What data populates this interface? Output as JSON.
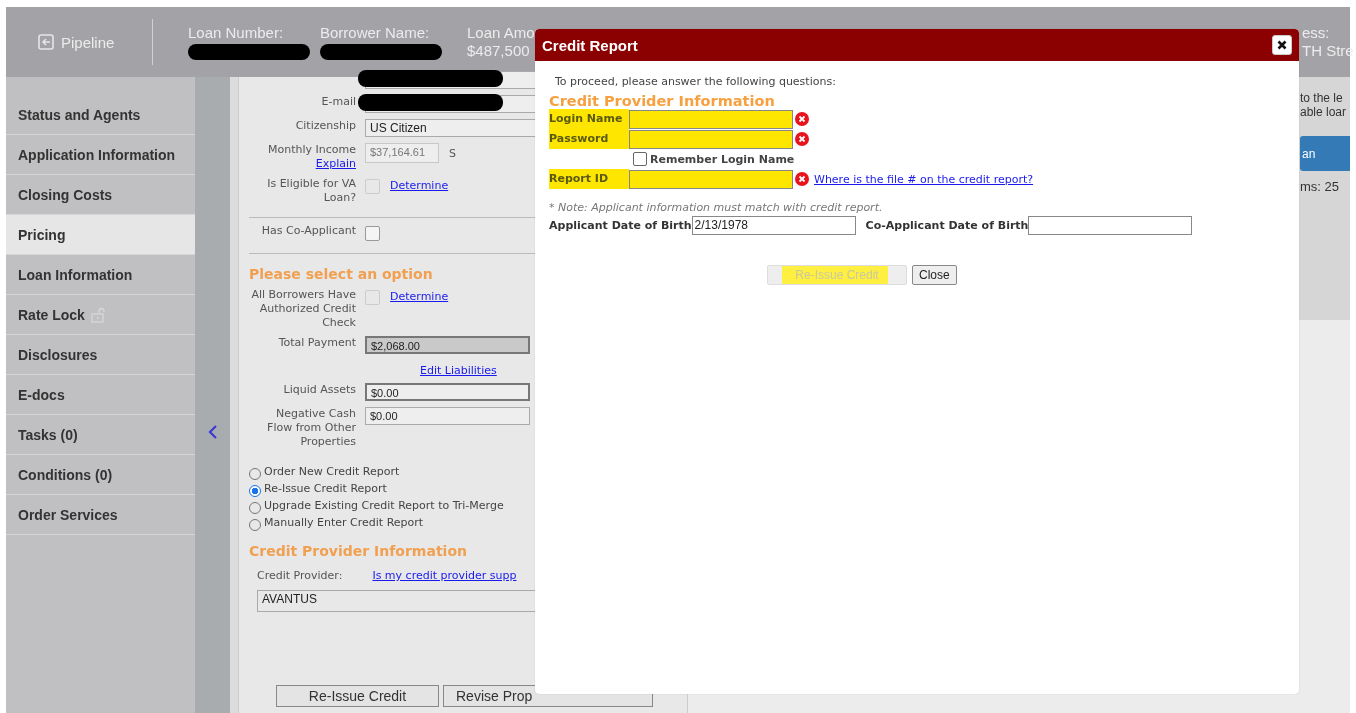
{
  "header": {
    "pipeline": "Pipeline",
    "fields": [
      {
        "label": "Loan Number:",
        "redacted": true
      },
      {
        "label": "Borrower Name:",
        "redacted": true
      },
      {
        "label": "Loan Amo",
        "value": "$487,500"
      }
    ],
    "right_field": {
      "label": "ess:",
      "value": "TH Stre"
    }
  },
  "sidebar": {
    "items": [
      {
        "label": "Status and Agents",
        "selected": false,
        "lock": false
      },
      {
        "label": "Application Information",
        "selected": false,
        "lock": false
      },
      {
        "label": "Closing Costs",
        "selected": false,
        "lock": false
      },
      {
        "label": "Pricing",
        "selected": true,
        "lock": false
      },
      {
        "label": "Loan Information",
        "selected": false,
        "lock": false
      },
      {
        "label": "Rate Lock",
        "selected": false,
        "lock": true
      },
      {
        "label": "Disclosures",
        "selected": false,
        "lock": false
      },
      {
        "label": "E-docs",
        "selected": false,
        "lock": false
      },
      {
        "label": "Tasks (0)",
        "selected": false,
        "lock": false
      },
      {
        "label": "Conditions (0)",
        "selected": false,
        "lock": false
      },
      {
        "label": "Order Services",
        "selected": false,
        "lock": false
      }
    ]
  },
  "form": {
    "rows": [
      {
        "kind": "input",
        "redacted": true
      },
      {
        "kind": "input",
        "label": "E-mail",
        "redacted": true
      },
      {
        "kind": "select",
        "label": "Citizenship",
        "value": "US Citizen"
      },
      {
        "kind": "input",
        "label": "Monthly Income",
        "link": "Explain",
        "value": "$37,164.61",
        "disabled": true,
        "readonly": false,
        "focused": false,
        "side_label": "S"
      },
      {
        "kind": "checkbox",
        "label": "Is Eligible for VA Loan?",
        "checked": false,
        "disabled": true,
        "link": "Determine"
      },
      {
        "kind": "divider"
      },
      {
        "kind": "checkbox",
        "label": "Has Co-Applicant",
        "checked": false,
        "disabled": false
      },
      {
        "kind": "divider"
      },
      {
        "kind": "heading",
        "text": "Please select an option"
      },
      {
        "kind": "checkbox",
        "label": "All Borrowers Have Authorized Credit Check",
        "checked": false,
        "disabled": true,
        "link": "Determine"
      },
      {
        "kind": "input",
        "label": "Total Payment",
        "value": "$2,068.00",
        "disabled": false,
        "readonly": true,
        "focused": false
      },
      {
        "kind": "link",
        "text": "Edit Liabilities"
      },
      {
        "kind": "input",
        "label": "Liquid Assets",
        "value": "$0.00",
        "disabled": false,
        "readonly": false,
        "focused": true
      },
      {
        "kind": "input",
        "label": "Negative Cash Flow from Other Properties",
        "value": "$0.00",
        "disabled": false,
        "readonly": false,
        "focused": false
      },
      {
        "kind": "radios",
        "options": [
          {
            "label": "Order New Credit Report",
            "selected": false
          },
          {
            "label": "Re-Issue Credit Report",
            "selected": true
          },
          {
            "label": "Upgrade Existing Credit Report to Tri-Merge",
            "selected": false
          },
          {
            "label": "Manually Enter Credit Report",
            "selected": false
          }
        ]
      },
      {
        "kind": "heading",
        "text": "Credit Provider Information"
      },
      {
        "kind": "label_link",
        "label": "Credit Provider:",
        "link": "Is my credit provider supp"
      },
      {
        "kind": "wide_select",
        "value": "AVANTUS"
      }
    ],
    "buttons": [
      "Re-Issue Credit",
      "Revise Prop"
    ]
  },
  "right": {
    "lines": [
      "to the le",
      "able loar"
    ],
    "button": "an",
    "count": "ms: 25"
  },
  "dialog": {
    "title": "Credit Report",
    "intro": "To proceed, please answer the following questions:",
    "heading": "Credit Provider Information",
    "fields": [
      {
        "kind": "input",
        "label": "Login Name",
        "highlighted": true,
        "error": true
      },
      {
        "kind": "input",
        "label": "Password",
        "highlighted": true,
        "error": true
      },
      {
        "kind": "checkbox",
        "label": "Remember Login Name",
        "checked": false
      },
      {
        "kind": "input",
        "label": "Report ID",
        "highlighted": true,
        "error": true,
        "link": "Where is the file # on the credit report?"
      }
    ],
    "note": "* Note: Applicant information must match with credit report.",
    "dob": [
      {
        "label": "Applicant Date of Birth",
        "value": "2/13/1978"
      },
      {
        "label": "Co-Applicant Date of Birth"
      }
    ],
    "buttons": [
      {
        "label": "Re-Issue Credit",
        "disabled": true,
        "highlighted": true
      },
      {
        "label": "Close",
        "disabled": false,
        "highlighted": false
      }
    ]
  }
}
